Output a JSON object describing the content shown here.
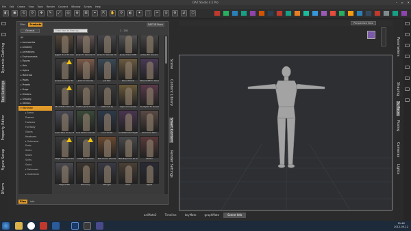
{
  "app": {
    "title": "DAZ Studio 4.5 Pro"
  },
  "menu": [
    "File",
    "Edit",
    "Create",
    "View",
    "Tools",
    "Render",
    "Connect",
    "Window",
    "Scripts",
    "Help"
  ],
  "lefttabs": [
    "Dynamic Clothing",
    "Tool Settings",
    "Property Editor",
    "Figure Setup",
    "DForm"
  ],
  "filter": {
    "tabs": [
      "Filter",
      "Products"
    ],
    "active": 1,
    "daz_button": "DAZ 3D Store"
  },
  "search": {
    "selected": "Genesis",
    "placeholder": "Enter text to filter by...",
    "count": "1 - 201"
  },
  "tree": [
    {
      "l": "All",
      "t": "root"
    },
    {
      "l": "▸ Accessories",
      "t": "root"
    },
    {
      "l": "▸ Anatomy",
      "t": "root"
    },
    {
      "l": "▸ Animations",
      "t": "root"
    },
    {
      "l": "▸ Environments",
      "t": "root"
    },
    {
      "l": "▸ Figures",
      "t": "root"
    },
    {
      "l": "▸ Hair",
      "t": "root"
    },
    {
      "l": "▸ Lights",
      "t": "root"
    },
    {
      "l": "▸ Materials",
      "t": "root"
    },
    {
      "l": "▸ Poses",
      "t": "root"
    },
    {
      "l": "▸ Presets",
      "t": "root"
    },
    {
      "l": "▸ Props",
      "t": "root"
    },
    {
      "l": "▸ Shaders",
      "t": "root"
    },
    {
      "l": "▸ Shaping",
      "t": "root"
    },
    {
      "l": "▸ Utilities",
      "t": "root"
    },
    {
      "l": "▾ Wardrobe",
      "t": "sel"
    },
    {
      "l": "▸ Armor",
      "t": "child"
    },
    {
      "l": "Dresses",
      "t": "child"
    },
    {
      "l": "Footwear",
      "t": "child"
    },
    {
      "l": "Full Body",
      "t": "child"
    },
    {
      "l": "Gloves",
      "t": "child"
    },
    {
      "l": "Headwear",
      "t": "child"
    },
    {
      "l": "▸ Outerwear",
      "t": "child"
    },
    {
      "l": "Pants",
      "t": "child"
    },
    {
      "l": "Shirts",
      "t": "child"
    },
    {
      "l": "Shoes",
      "t": "child"
    },
    {
      "l": "Skirts",
      "t": "child"
    },
    {
      "l": "Socks",
      "t": "child"
    },
    {
      "l": "▸ Swimwear",
      "t": "child"
    },
    {
      "l": "▸ Underwear",
      "t": "child"
    }
  ],
  "thumbs": [
    {
      "l": "Jagged Cloud for Genesis",
      "c": "#5a4a3a"
    },
    {
      "l": "Jaclyn for Genesis Character and Hair",
      "c": "#6a5a5a"
    },
    {
      "l": "Jaclyn for Genesis Clothing and Accessories",
      "c": "#4a4a50"
    },
    {
      "l": "Jersey Dress Outfit",
      "c": "#5a5a5a"
    },
    {
      "l": "Jockey Fan Genesis",
      "c": "#4a4a4a"
    },
    {
      "l": "Jouissance Cooler for Genesis",
      "c": "#3a3a3a",
      "w": 1
    },
    {
      "l": "Julian for Genesis",
      "c": "#7a5a4a"
    },
    {
      "l": "Just Past",
      "c": "#3b4a55"
    },
    {
      "l": "Kasual Breeze",
      "c": "#6b5a40"
    },
    {
      "l": "Kataa Outfit for Genesis",
      "c": "#4a3a55"
    },
    {
      "l": "Kilo & Baker Vision for Genesis",
      "c": "#3a3a3a",
      "w": 1
    },
    {
      "l": "Leather Jacket for Genesis",
      "c": "#4a4540"
    },
    {
      "l": "Leathernet by",
      "c": "#3a3a3a"
    },
    {
      "l": "Legion for Genesis",
      "c": "#6a5a3a"
    },
    {
      "l": "Lily Stylish for Genesis",
      "c": "#5a3a4a"
    },
    {
      "l": "Liquid Nails for Dry M4 for Genesis",
      "c": "#4a4a55"
    },
    {
      "l": "Lone Wolf for Genesis",
      "c": "#3a4a3a"
    },
    {
      "l": "Lunar Hunter",
      "c": "#2e3a4a"
    },
    {
      "l": "LunaMeta Dark Nights for Genesis",
      "c": "#4a3550"
    },
    {
      "l": "M4 Casual Attire",
      "c": "#5a4a45"
    },
    {
      "l": "Khajiit Set for Genesis",
      "c": "#3a3a3a",
      "w": 1
    },
    {
      "l": "Khajiit for Genesis",
      "c": "#3a3a3a",
      "w": 1
    },
    {
      "l": "Mad Girl for Genesis",
      "c": "#6a4a30"
    },
    {
      "l": "MEG Expansion for Genesis",
      "c": "#4a4a4a"
    },
    {
      "l": "Medina",
      "c": "#5a3a3a"
    },
    {
      "l": "Mega Outfit",
      "c": "#4a4a50"
    },
    {
      "l": "Mercenary",
      "c": "#3a3530"
    },
    {
      "l": "Midnight",
      "c": "#3a3a45"
    },
    {
      "l": "Monk",
      "c": "#4a4035"
    },
    {
      "l": "Nights",
      "c": "#2a2a35"
    }
  ],
  "bottomtabs": [
    "Files",
    "Info"
  ],
  "midtabs": [
    "Scene",
    "Content Library",
    "Smart Content",
    "Render Settings"
  ],
  "rtabs": [
    "Parameters",
    "Shaping",
    "Surfaces",
    "Posing",
    "Cameras",
    "Lights"
  ],
  "viewport": {
    "camera": "Perspective View"
  },
  "bottombar": {
    "tabs": [
      "aniMate2",
      "Timeline",
      "keyMate",
      "graphMate",
      "Scene Info"
    ],
    "active": 4
  },
  "clock": {
    "time": "15:48",
    "date": "2012-05-12"
  }
}
